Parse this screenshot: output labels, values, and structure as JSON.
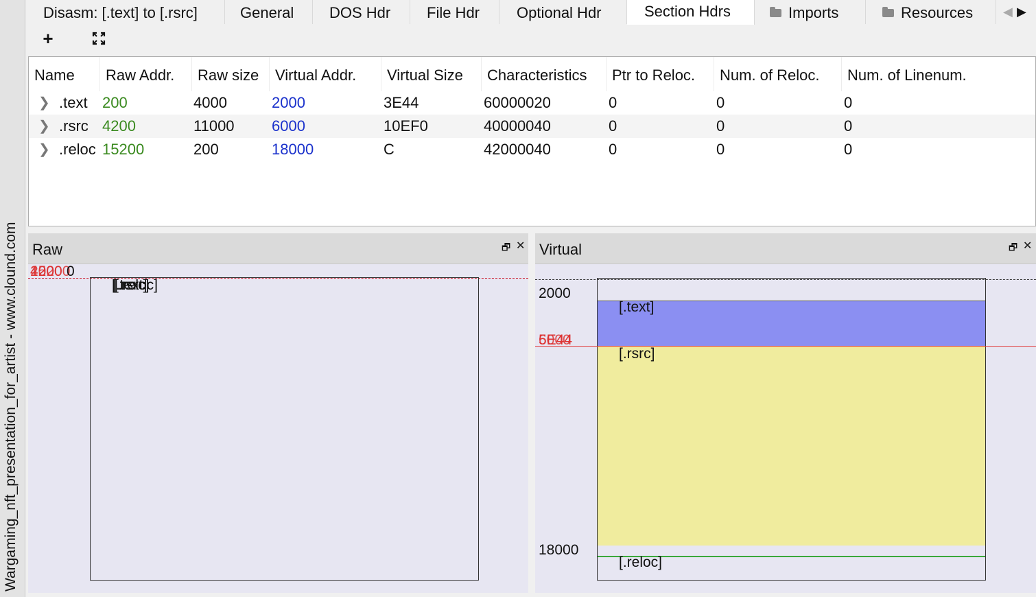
{
  "sidebar": {
    "watermark": "Wargaming_nft_presentation_for_artist - www.clound.com"
  },
  "tabs": [
    {
      "label": "Disasm: [.text] to [.rsrc]",
      "icon": ""
    },
    {
      "label": "General",
      "icon": ""
    },
    {
      "label": "DOS Hdr",
      "icon": ""
    },
    {
      "label": "File Hdr",
      "icon": ""
    },
    {
      "label": "Optional Hdr",
      "icon": ""
    },
    {
      "label": "Section Hdrs",
      "icon": "",
      "active": true
    },
    {
      "label": "Imports",
      "icon": "folder-icon"
    },
    {
      "label": "Resources",
      "icon": "folder-icon"
    }
  ],
  "toolbar": {
    "add_icon": "+",
    "expand_icon": "fit-view-icon"
  },
  "table": {
    "columns": [
      "Name",
      "Raw Addr.",
      "Raw size",
      "Virtual Addr.",
      "Virtual Size",
      "Characteristics",
      "Ptr to Reloc.",
      "Num. of Reloc.",
      "Num. of Linenum."
    ],
    "rows": [
      [
        "200",
        "4000",
        "2000",
        "3E44",
        "60000020",
        "0",
        "0",
        "0"
      ],
      [
        "4200",
        "11000",
        "6000",
        "10EF0",
        "40000040",
        "0",
        "0",
        "0"
      ],
      [
        "15200",
        "200",
        "18000",
        "C",
        "42000040",
        "0",
        "0",
        "0"
      ]
    ],
    "names": [
      ".text",
      ".rsrc",
      ".reloc"
    ]
  },
  "raw_panel": {
    "title": "Raw",
    "addr_labels": [
      "4200",
      "15200",
      "200"
    ],
    "addr_label_black": "0",
    "section_labels": [
      "[.text]",
      "[.rsrc]",
      "[.reloc]"
    ]
  },
  "virtual_panel": {
    "title": "Virtual",
    "addr_top": "2000",
    "addr_mid_a": "5E44",
    "addr_mid_b": "6000",
    "addr_bottom": "18000",
    "section_labels": [
      "[.text]",
      "[.rsrc]",
      "[.reloc]"
    ]
  },
  "colors": {
    "text_section": "#8b8ff2",
    "rsrc_section": "#f0ec9e",
    "reloc_line": "#3aa83a",
    "marker_line": "#e03a3a"
  }
}
